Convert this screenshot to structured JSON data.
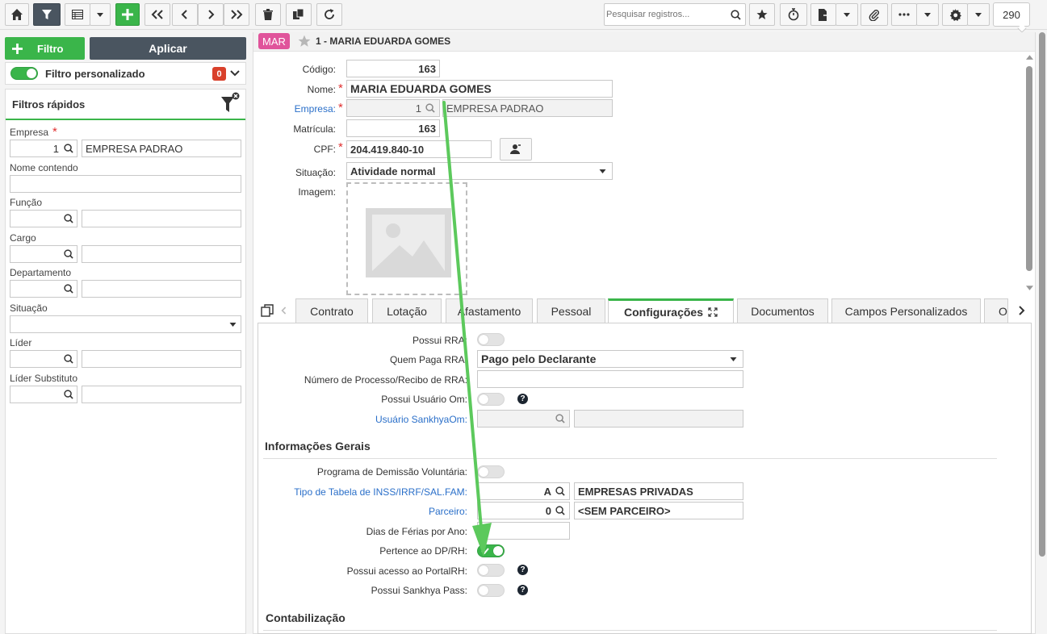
{
  "toolbar": {
    "search_placeholder": "Pesquisar registros...",
    "record_count": "290"
  },
  "filters": {
    "add_filter_label": "Filtro",
    "apply_label": "Aplicar",
    "custom_filter_label": "Filtro personalizado",
    "custom_filter_count": "0",
    "quick_filters_title": "Filtros rápidos",
    "fields": {
      "empresa_label": "Empresa",
      "empresa_code": "1",
      "empresa_name": "EMPRESA PADRAO",
      "nome_label": "Nome contendo",
      "funcao_label": "Função",
      "cargo_label": "Cargo",
      "departamento_label": "Departamento",
      "situacao_label": "Situação",
      "lider_label": "Líder",
      "lider_sub_label": "Líder Substituto"
    }
  },
  "record": {
    "badge": "MAR",
    "title": "1 - MARIA EDUARDA GOMES",
    "codigo_label": "Código:",
    "codigo": "163",
    "nome_label": "Nome:",
    "nome": "MARIA EDUARDA GOMES",
    "empresa_label": "Empresa:",
    "empresa_code": "1",
    "empresa_name": "EMPRESA PADRAO",
    "matricula_label": "Matrícula:",
    "matricula": "163",
    "cpf_label": "CPF:",
    "cpf": "204.419.840-10",
    "situacao_label": "Situação:",
    "situacao": "Atividade normal",
    "imagem_label": "Imagem:"
  },
  "tabs": [
    "Contrato",
    "Lotação",
    "Afastamento",
    "Pessoal",
    "Configurações",
    "Documentos",
    "Campos Personalizados",
    "O"
  ],
  "config": {
    "possui_rra_label": "Possui RRA:",
    "quem_paga_label": "Quem Paga RRA:",
    "quem_paga_value": "Pago pelo Declarante",
    "num_processo_label": "Número de Processo/Recibo de RRA:",
    "possui_usuario_label": "Possui Usuário Om:",
    "usuario_sankhya_label": "Usuário SankhyaOm:",
    "info_gerais_title": "Informações Gerais",
    "programa_demissao_label": "Programa de Demissão Voluntária:",
    "tipo_tabela_label": "Tipo de Tabela de INSS/IRRF/SAL.FAM:",
    "tipo_tabela_code": "A",
    "tipo_tabela_name": "EMPRESAS PRIVADAS",
    "parceiro_label": "Parceiro:",
    "parceiro_code": "0",
    "parceiro_name": "<SEM PARCEIRO>",
    "dias_ferias_label": "Dias de Férias por Ano:",
    "pertence_dp_label": "Pertence ao DP/RH:",
    "possui_portal_label": "Possui acesso ao PortalRH:",
    "possui_pass_label": "Possui Sankhya Pass:",
    "contabilizacao_title": "Contabilização",
    "pertence_dp_on": true
  },
  "colors": {
    "accent_green": "#3ab54a",
    "badge_pink": "#e0549b",
    "annotation_arrow": "#5cc95c",
    "link_blue": "#2a6fc9"
  }
}
